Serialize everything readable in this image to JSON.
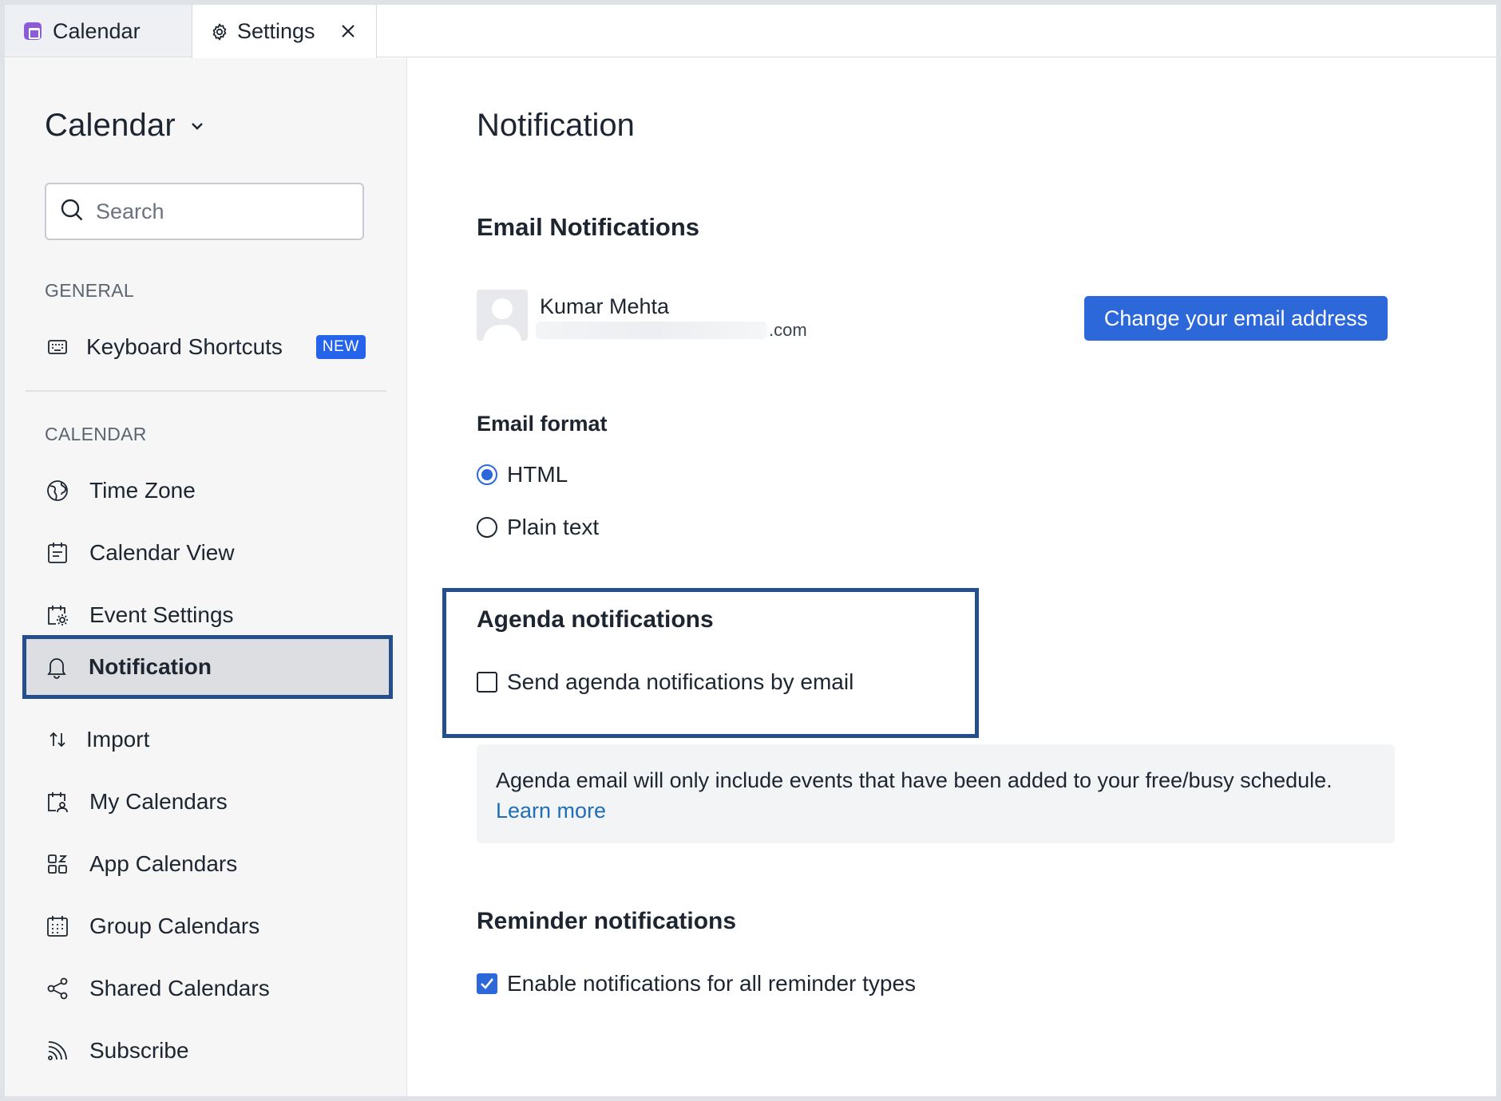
{
  "tabs": [
    {
      "label": "Calendar",
      "icon": "calendar-app-icon"
    },
    {
      "label": "Settings",
      "icon": "gear-icon",
      "close_icon": "close-icon"
    }
  ],
  "sidebar": {
    "app_title": "Calendar",
    "search_placeholder": "Search",
    "general_label": "GENERAL",
    "general_items": [
      {
        "label": "Keyboard Shortcuts",
        "icon": "keyboard-icon",
        "badge": "NEW"
      }
    ],
    "calendar_label": "CALENDAR",
    "calendar_items": [
      {
        "label": "Time Zone",
        "icon": "globe-icon"
      },
      {
        "label": "Calendar View",
        "icon": "calendar-view-icon"
      },
      {
        "label": "Event Settings",
        "icon": "event-settings-icon"
      },
      {
        "label": "Notification",
        "icon": "bell-icon",
        "active": true
      },
      {
        "label": "Import",
        "icon": "import-arrows-icon"
      },
      {
        "label": "My Calendars",
        "icon": "my-calendars-icon"
      },
      {
        "label": "App Calendars",
        "icon": "apps-grid-icon"
      },
      {
        "label": "Group Calendars",
        "icon": "group-calendar-icon"
      },
      {
        "label": "Shared Calendars",
        "icon": "share-icon"
      },
      {
        "label": "Subscribe",
        "icon": "rss-icon"
      }
    ]
  },
  "main": {
    "title": "Notification",
    "email_notifications": {
      "heading": "Email Notifications",
      "user_name": "Kumar Mehta",
      "email_suffix": ".com",
      "change_button": "Change your email address"
    },
    "email_format": {
      "heading": "Email format",
      "options": [
        {
          "label": "HTML",
          "selected": true
        },
        {
          "label": "Plain text",
          "selected": false
        }
      ]
    },
    "agenda": {
      "heading": "Agenda notifications",
      "checkbox_label": "Send agenda notifications by email",
      "checked": false,
      "info_text": "Agenda email will only include events that have been added to your free/busy schedule.",
      "learn_more": "Learn more"
    },
    "reminder": {
      "heading": "Reminder notifications",
      "checkbox_label": "Enable notifications for all reminder types",
      "checked": true
    }
  },
  "colors": {
    "accent": "#2d68db",
    "highlight_border": "#244f8c",
    "link": "#1e6fb8",
    "sidebar_bg": "#f6f6f6"
  }
}
